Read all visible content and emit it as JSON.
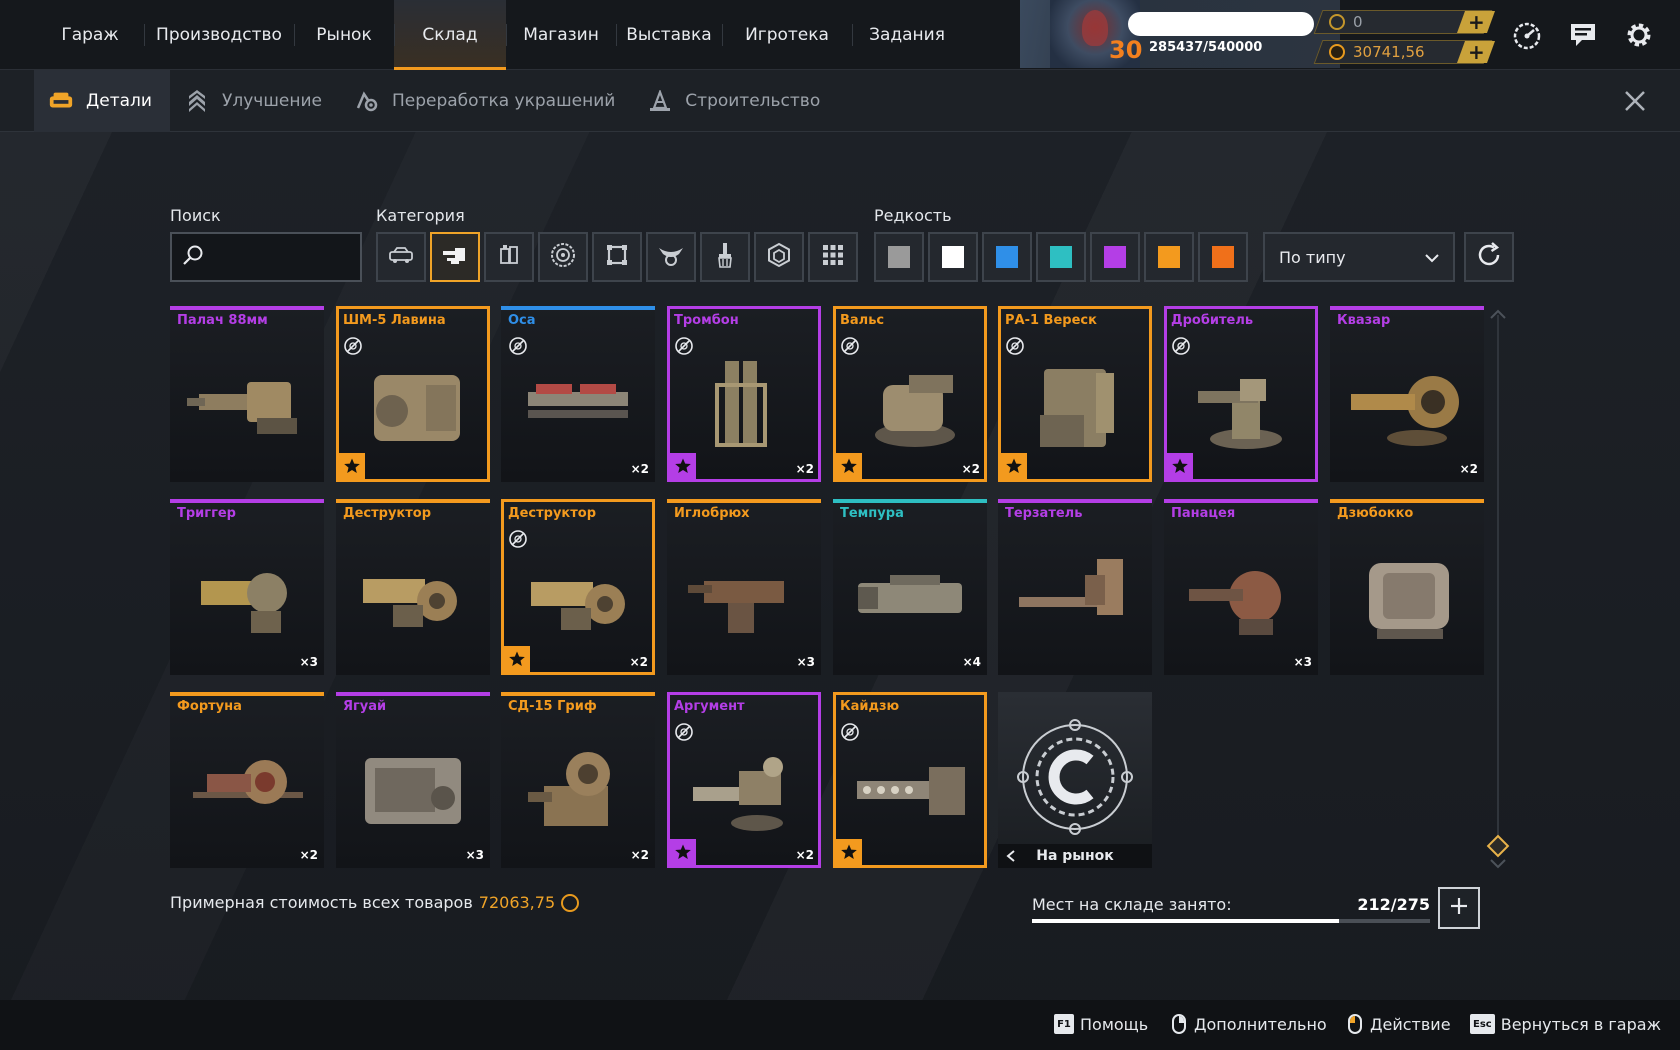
{
  "nav": {
    "items": [
      "Гараж",
      "Производство",
      "Рынок",
      "Склад",
      "Магазин",
      "Выставка",
      "Игротека",
      "Задания"
    ],
    "active_index": 3
  },
  "profile": {
    "level": "30",
    "xp": "285437/540000",
    "currency_1": "0",
    "currency_2": "30741,56"
  },
  "subtabs": {
    "items": [
      "Детали",
      "Улучшение",
      "Переработка украшений",
      "Строительство"
    ],
    "active_index": 0
  },
  "filters": {
    "search_label": "Поиск",
    "search_value": "",
    "category_label": "Категория",
    "categories": [
      "cabin-icon",
      "weapon-icon",
      "modules-icon",
      "wheels-icon",
      "frames-icon",
      "decor-icon",
      "paint-icon",
      "parts-icon",
      "all-icon"
    ],
    "category_active_index": 1,
    "rarity_label": "Редкость",
    "rarity_colors": [
      "#9a9a9a",
      "#ffffff",
      "#2f8fe8",
      "#2ebfc2",
      "#b43ee6",
      "#f39a1e",
      "#f0701a"
    ],
    "sort_value": "По типу"
  },
  "colors": {
    "accent": "#f39a1e",
    "rarity_common": "#9a9a9a",
    "rarity_rare": "#2f8fe8",
    "rarity_special": "#2ebfc2",
    "rarity_epic": "#b43ee6",
    "rarity_legendary": "#f39a1e"
  },
  "items": [
    {
      "name": "Палач 88мм",
      "rarity": "epic",
      "framed": false,
      "no_trade": false,
      "qty": "",
      "star": false
    },
    {
      "name": "ШМ-5 Лавина",
      "rarity": "legendary",
      "framed": true,
      "no_trade": true,
      "qty": "",
      "star": true
    },
    {
      "name": "Оса",
      "rarity": "rare",
      "framed": false,
      "no_trade": true,
      "qty": "×2",
      "star": false
    },
    {
      "name": "Тромбон",
      "rarity": "epic",
      "framed": true,
      "no_trade": true,
      "qty": "×2",
      "star": true
    },
    {
      "name": "Вальс",
      "rarity": "legendary",
      "framed": true,
      "no_trade": true,
      "qty": "×2",
      "star": true
    },
    {
      "name": "РА-1 Вереск",
      "rarity": "legendary",
      "framed": true,
      "no_trade": true,
      "qty": "",
      "star": true
    },
    {
      "name": "Дробитель",
      "rarity": "epic",
      "framed": true,
      "no_trade": true,
      "qty": "",
      "star": true
    },
    {
      "name": "Квазар",
      "rarity": "epic",
      "framed": false,
      "no_trade": false,
      "qty": "×2",
      "star": false
    },
    {
      "name": "Триггер",
      "rarity": "epic",
      "framed": false,
      "no_trade": false,
      "qty": "×3",
      "star": false
    },
    {
      "name": "Деструктор",
      "rarity": "legendary",
      "framed": false,
      "no_trade": false,
      "qty": "",
      "star": false
    },
    {
      "name": "Деструктор",
      "rarity": "legendary",
      "framed": true,
      "no_trade": true,
      "qty": "×2",
      "star": true
    },
    {
      "name": "Иглобрюх",
      "rarity": "legendary",
      "framed": false,
      "no_trade": false,
      "qty": "×3",
      "star": false
    },
    {
      "name": "Темпура",
      "rarity": "special",
      "framed": false,
      "no_trade": false,
      "qty": "×4",
      "star": false
    },
    {
      "name": "Терзатель",
      "rarity": "epic",
      "framed": false,
      "no_trade": false,
      "qty": "",
      "star": false
    },
    {
      "name": "Панацея",
      "rarity": "epic",
      "framed": false,
      "no_trade": false,
      "qty": "×3",
      "star": false
    },
    {
      "name": "Дзюбокко",
      "rarity": "legendary",
      "framed": false,
      "no_trade": false,
      "qty": "",
      "star": false
    },
    {
      "name": "Фортуна",
      "rarity": "legendary",
      "framed": false,
      "no_trade": false,
      "qty": "×2",
      "star": false
    },
    {
      "name": "Ягуай",
      "rarity": "epic",
      "framed": false,
      "no_trade": false,
      "qty": "×3",
      "star": false
    },
    {
      "name": "СД-15 Гриф",
      "rarity": "legendary",
      "framed": false,
      "no_trade": false,
      "qty": "×2",
      "star": false
    },
    {
      "name": "Аргумент",
      "rarity": "epic",
      "framed": true,
      "no_trade": true,
      "qty": "×2",
      "star": true
    },
    {
      "name": "Кайдзю",
      "rarity": "legendary",
      "framed": true,
      "no_trade": true,
      "qty": "",
      "star": true
    }
  ],
  "market_card": {
    "label": "На рынок"
  },
  "footer": {
    "total_label": "Примерная стоимость всех товаров",
    "total_value": "72063,75",
    "storage_label": "Мест на складе занято:",
    "storage_value": "212/275",
    "storage_fill_fraction": 0.771
  },
  "hints": [
    {
      "key": "F1",
      "label": "Помощь",
      "kind": "key"
    },
    {
      "key": "",
      "label": "Дополнительно",
      "kind": "mouse-right"
    },
    {
      "key": "",
      "label": "Действие",
      "kind": "mouse-left"
    },
    {
      "key": "Esc",
      "label": "Вернуться в гараж",
      "kind": "key"
    }
  ]
}
